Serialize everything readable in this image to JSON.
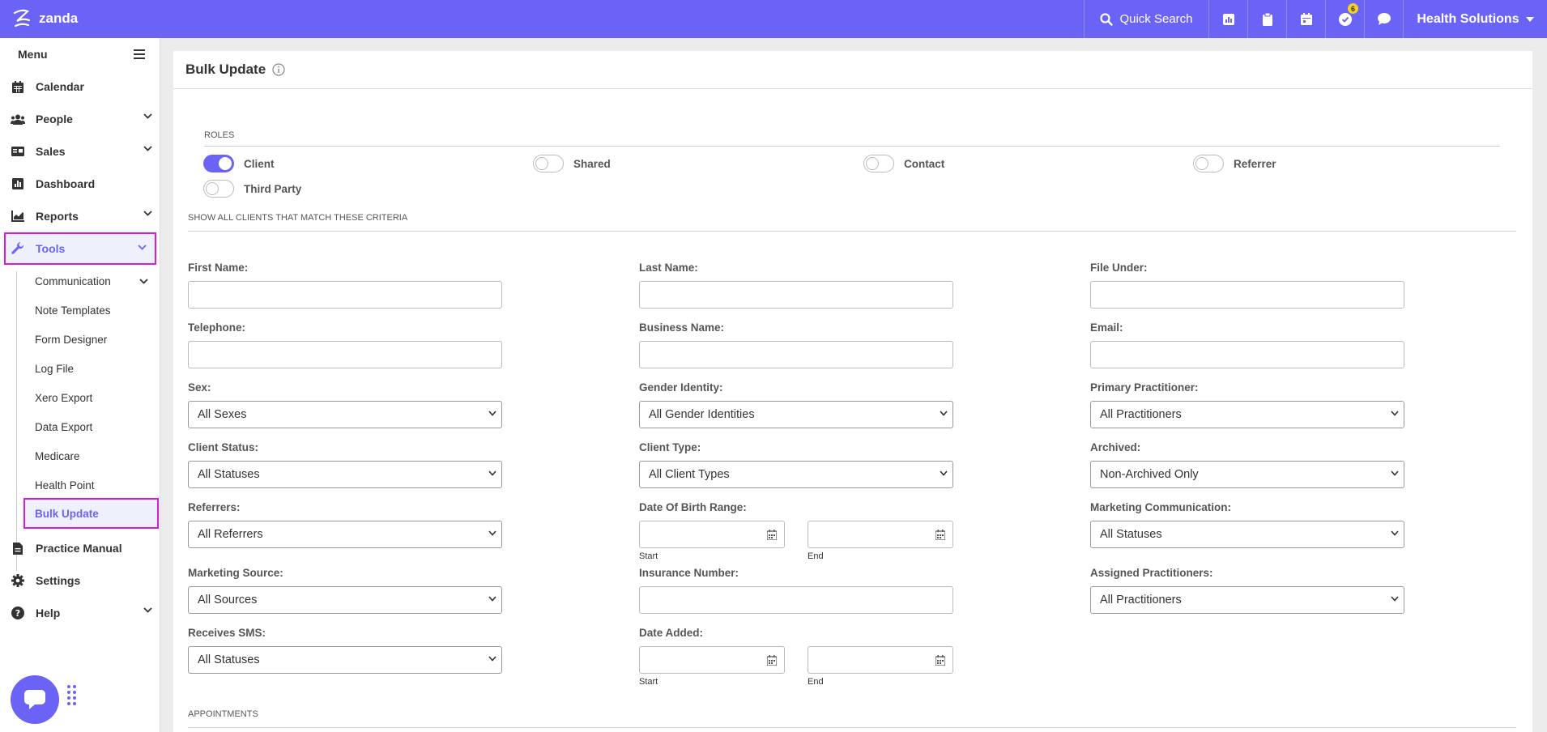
{
  "topbar": {
    "logo_text": "zanda",
    "search_label": "Quick Search",
    "tasks_badge": "6",
    "org_name": "Health Solutions",
    "accent_color": "#6a63f5",
    "icons": [
      "chart-icon",
      "clipboard-icon",
      "calendar-icon",
      "tasks-check-icon",
      "chat-icon"
    ]
  },
  "sidebar": {
    "menu_label": "Menu",
    "items": [
      {
        "label": "Calendar",
        "icon": "calendar-icon"
      },
      {
        "label": "People",
        "icon": "people-icon"
      },
      {
        "label": "Sales",
        "icon": "sales-icon"
      },
      {
        "label": "Dashboard",
        "icon": "dashboard-icon"
      },
      {
        "label": "Reports",
        "icon": "reports-icon"
      },
      {
        "label": "Tools",
        "icon": "wrench-icon"
      },
      {
        "label": "Practice Manual",
        "icon": "document-icon"
      },
      {
        "label": "Settings",
        "icon": "gear-icon"
      },
      {
        "label": "Help",
        "icon": "help-icon"
      }
    ],
    "tools_sub": [
      "Communication",
      "Note Templates",
      "Form Designer",
      "Log File",
      "Xero Export",
      "Data Export",
      "Medicare",
      "Health Point",
      "Bulk Update"
    ]
  },
  "page": {
    "title": "Bulk Update",
    "roles_label": "ROLES",
    "roles": [
      {
        "label": "Client",
        "on": true
      },
      {
        "label": "Shared",
        "on": false
      },
      {
        "label": "Contact",
        "on": false
      },
      {
        "label": "Referrer",
        "on": false
      },
      {
        "label": "Third Party",
        "on": false
      }
    ],
    "criteria_label": "SHOW ALL CLIENTS THAT MATCH THESE CRITERIA",
    "fields": {
      "first_name": "First Name:",
      "last_name": "Last Name:",
      "file_under": "File Under:",
      "telephone": "Telephone:",
      "business_name": "Business Name:",
      "email": "Email:",
      "sex": "Sex:",
      "gender_identity": "Gender Identity:",
      "primary_practitioner": "Primary Practitioner:",
      "client_status": "Client Status:",
      "client_type": "Client Type:",
      "archived": "Archived:",
      "referrers": "Referrers:",
      "dob_range": "Date Of Birth Range:",
      "marketing_communication": "Marketing Communication:",
      "marketing_source": "Marketing Source:",
      "insurance_number": "Insurance Number:",
      "assigned_practitioners": "Assigned Practitioners:",
      "receives_sms": "Receives SMS:",
      "date_added": "Date Added:"
    },
    "selects": {
      "sex": "All Sexes",
      "gender_identity": "All Gender Identities",
      "primary_practitioner": "All Practitioners",
      "client_status": "All Statuses",
      "client_type": "All Client Types",
      "archived": "Non-Archived Only",
      "referrers": "All Referrers",
      "marketing_communication": "All Statuses",
      "marketing_source": "All Sources",
      "assigned_practitioners": "All Practitioners",
      "receives_sms": "All Statuses"
    },
    "date_sub": {
      "start": "Start",
      "end": "End"
    },
    "appointments_label": "APPOINTMENTS"
  }
}
